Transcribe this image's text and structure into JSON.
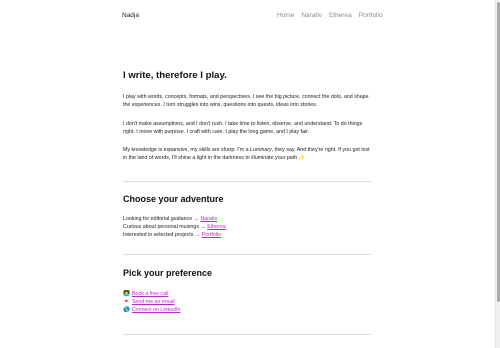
{
  "header": {
    "brand": "Nadja",
    "nav": [
      "Home",
      "Narativ",
      "Etherea",
      "Portfolio"
    ]
  },
  "intro": {
    "title": "I write, therefore I play.",
    "p1": "I play with words, concepts, formats, and perspectives. I see the big picture, connect the dots, and shape the experiences. I turn struggles into wins, questions into quests, ideas into stories.",
    "p2": "I don't make assumptions, and I don't rush. I take time to listen, observe, and understand. To do things right. I move with purpose. I craft with care. I play the long game, and I play fair.",
    "p3_before": "My knowledge is expansive, my skills are sharp. I'm a ",
    "p3_em": "Luminary",
    "p3_after": ", they say. And they're right. If you get lost in the land of words, I'll shine a light in the darkness to illuminate your path ✨"
  },
  "adventure": {
    "title": "Choose your adventure",
    "rows": [
      {
        "text": "Looking for editorial guidance → ",
        "link": "Narativ"
      },
      {
        "text": "Curious about personal musings → ",
        "link": "Etherea"
      },
      {
        "text": "Interested in selected projects → ",
        "link": "Portfolio"
      }
    ]
  },
  "preference": {
    "title": "Pick your preference",
    "rows": [
      {
        "icon": "👩‍💻",
        "link": "Book a free call"
      },
      {
        "icon": "💌",
        "link": "Send me an email"
      },
      {
        "icon": "🌎",
        "link": "Connect on LinkedIn"
      }
    ]
  },
  "colors": {
    "accent_link": "#c026d3",
    "nav_text": "#8a8a8a",
    "divider": "#dcdcdc"
  }
}
